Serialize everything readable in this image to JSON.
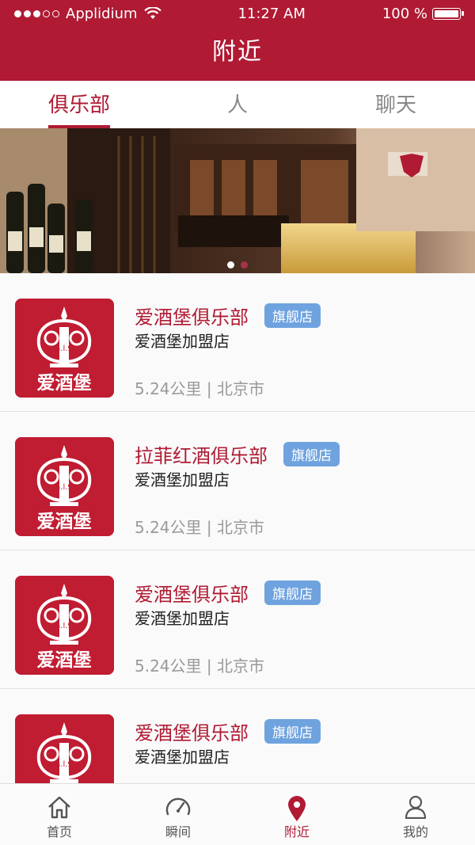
{
  "status_bar": {
    "carrier": "Applidium",
    "time": "11:27 AM",
    "battery": "100 %"
  },
  "header": {
    "title": "附近"
  },
  "tabs": [
    {
      "label": "俱乐部",
      "active": true
    },
    {
      "label": "人",
      "active": false
    },
    {
      "label": "聊天",
      "active": false
    }
  ],
  "banner": {
    "page_count": 2,
    "current_page": 1
  },
  "clubs": [
    {
      "name": "爱酒堡俱乐部",
      "badge": "旗舰店",
      "subtitle": "爱酒堡加盟店",
      "distance": "5.24公里",
      "city": "北京市",
      "meta": "5.24公里 | 北京市"
    },
    {
      "name": "拉菲红酒俱乐部",
      "badge": "旗舰店",
      "subtitle": "爱酒堡加盟店",
      "distance": "5.24公里",
      "city": "北京市",
      "meta": "5.24公里 | 北京市"
    },
    {
      "name": "爱酒堡俱乐部",
      "badge": "旗舰店",
      "subtitle": "爱酒堡加盟店",
      "distance": "5.24公里",
      "city": "北京市",
      "meta": "5.24公里 | 北京市"
    },
    {
      "name": "爱酒堡俱乐部",
      "badge": "旗舰店",
      "subtitle": "爱酒堡加盟店",
      "distance": "",
      "city": "",
      "meta": ""
    }
  ],
  "logo": {
    "brand": "爱酒堡",
    "emblem": "a.l.9"
  },
  "bottom_nav": [
    {
      "label": "首页",
      "icon": "home-icon",
      "active": false
    },
    {
      "label": "瞬间",
      "icon": "gauge-icon",
      "active": false
    },
    {
      "label": "附近",
      "icon": "location-pin-icon",
      "active": true
    },
    {
      "label": "我的",
      "icon": "user-icon",
      "active": false
    }
  ],
  "colors": {
    "brand": "#b01a33",
    "badge": "#6fa3df",
    "logo_bg": "#c01c32"
  }
}
